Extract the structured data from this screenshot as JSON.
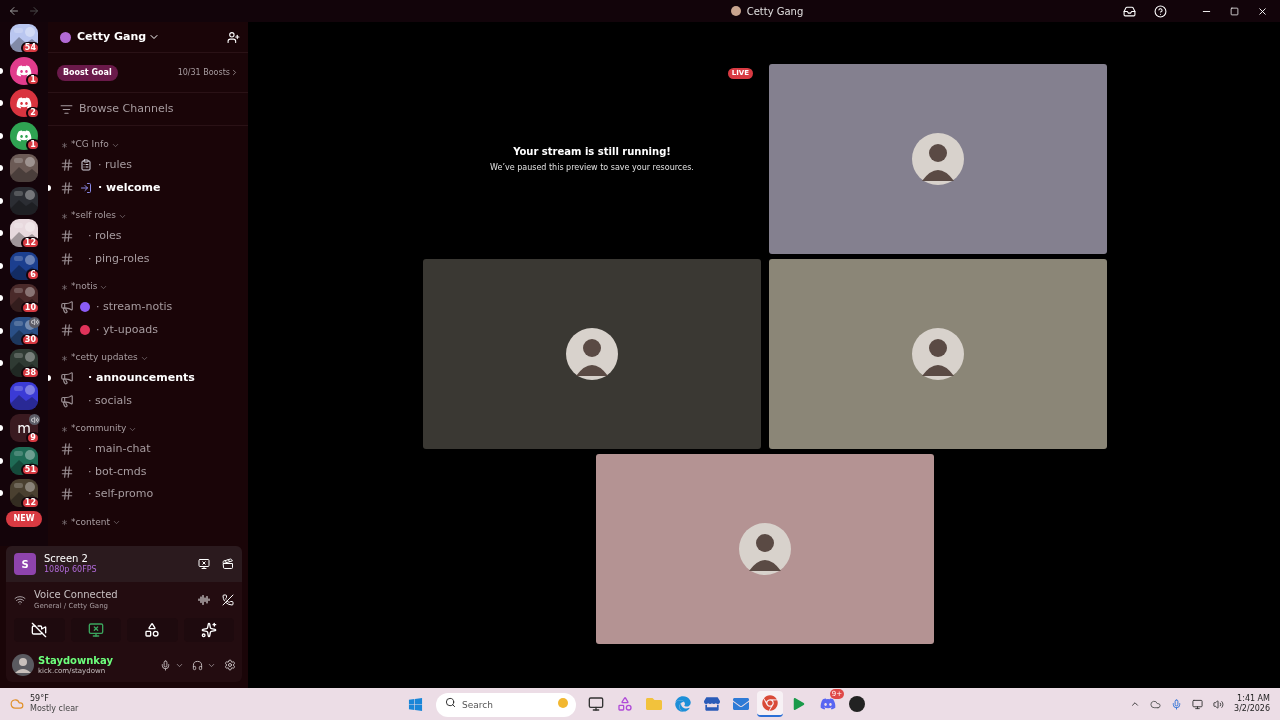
{
  "title_bar": {
    "title": "Cetty Gang"
  },
  "servers": [
    {
      "kind": "picture",
      "color": "#b9c6f0",
      "badge": "54"
    },
    {
      "kind": "discord",
      "color": "#e13c8c",
      "badge": "1",
      "unread": true
    },
    {
      "kind": "discord",
      "color": "#d9343f",
      "badge": "2",
      "unread": true
    },
    {
      "kind": "discord",
      "color": "#2fa352",
      "badge": "1",
      "unread": true
    },
    {
      "kind": "picture",
      "color": "#6b5a55",
      "unread": true
    },
    {
      "kind": "picture",
      "color": "#2b2d33",
      "unread": true
    },
    {
      "kind": "picture",
      "color": "#e8d9de",
      "badge": "12",
      "unread": true
    },
    {
      "kind": "picture",
      "color": "#1c3f8f",
      "badge": "6",
      "unread": true
    },
    {
      "kind": "picture",
      "color": "#4a2a2a",
      "badge": "10",
      "unread": true
    },
    {
      "kind": "picture",
      "color": "#2a4f86",
      "badge": "30",
      "unread": true,
      "speaker": true
    },
    {
      "kind": "picture",
      "color": "#2f3a33",
      "badge": "38",
      "unread": true
    },
    {
      "kind": "picture",
      "color": "#3b3bd6"
    },
    {
      "kind": "letter",
      "letter": "m",
      "color": "#3a1a20",
      "badge": "9",
      "unread": true,
      "speaker": true
    },
    {
      "kind": "picture",
      "color": "#1f6b55",
      "badge": "51",
      "unread": true
    },
    {
      "kind": "picture",
      "color": "#4a4030",
      "badge": "12",
      "unread": true
    }
  ],
  "new_badge": "NEW",
  "guild": {
    "name": "Cetty Gang",
    "boost_label": "Boost Goal",
    "boost_count": "10/31 Boosts",
    "browse": "Browse Channels"
  },
  "categories": [
    {
      "name": "*CG Info",
      "channels": [
        {
          "kind": "text",
          "emoji": {
            "kind": "clipboard"
          },
          "name": "· rules",
          "unread": false
        },
        {
          "kind": "text",
          "emoji": {
            "kind": "door"
          },
          "name": "· welcome",
          "unread": true
        }
      ]
    },
    {
      "name": "*self roles",
      "channels": [
        {
          "kind": "text",
          "name": "· roles",
          "unread": false
        },
        {
          "kind": "text",
          "name": "· ping-roles",
          "unread": false
        }
      ]
    },
    {
      "name": "*notis",
      "channels": [
        {
          "kind": "announcement",
          "emoji": {
            "kind": "dot",
            "color": "#8b5cf6"
          },
          "name": "· stream-notis",
          "unread": false
        },
        {
          "kind": "text",
          "emoji": {
            "kind": "dot",
            "color": "#e0335a"
          },
          "name": "· yt-upoads",
          "unread": false
        }
      ]
    },
    {
      "name": "*cetty updates",
      "channels": [
        {
          "kind": "announcement",
          "name": "· announcements",
          "unread": true
        },
        {
          "kind": "announcement",
          "name": "· socials",
          "unread": false
        }
      ]
    },
    {
      "name": "*community",
      "channels": [
        {
          "kind": "text",
          "name": "· main-chat",
          "unread": false
        },
        {
          "kind": "text",
          "name": "· bot-cmds",
          "unread": false
        },
        {
          "kind": "text",
          "name": "· self-promo",
          "unread": false
        }
      ]
    },
    {
      "name": "*content"
    }
  ],
  "stream": {
    "letter": "S",
    "title": "Screen 2",
    "quality": "1080p 60FPS"
  },
  "voice": {
    "status": "Voice Connected",
    "channel": "General / Cetty Gang"
  },
  "voice_actions": [
    {
      "kind": "camera_off"
    },
    {
      "kind": "screen_stop"
    },
    {
      "kind": "activities"
    },
    {
      "kind": "soundboard"
    }
  ],
  "user": {
    "name": "Staydownkay",
    "status": "kick.com/staydown"
  },
  "main": {
    "live_badge": "LIVE",
    "paused_title": "Your stream is still running!",
    "paused_text": "We’ve paused this preview to save your resources.",
    "tiles": [
      {
        "color": "#84808f"
      },
      {
        "color": "#3a3833"
      },
      {
        "color": "#8b8677"
      },
      {
        "color": "#b49393"
      }
    ]
  },
  "taskbar": {
    "weather_temp": "59°F",
    "weather_text": "Mostly clear",
    "search_placeholder": "Search",
    "apps": [
      {
        "kind": "files",
        "active": false
      },
      {
        "kind": "m365",
        "active": false
      },
      {
        "kind": "folder",
        "active": false
      },
      {
        "kind": "edge",
        "active": false
      },
      {
        "kind": "store",
        "active": false
      },
      {
        "kind": "outlook",
        "active": false
      },
      {
        "kind": "chrome",
        "active": true
      },
      {
        "kind": "play",
        "active": false
      },
      {
        "kind": "discord",
        "active": false,
        "badge": "9+"
      },
      {
        "kind": "app",
        "active": false
      }
    ],
    "time": "1:41 AM",
    "date": "3/2/2026"
  }
}
